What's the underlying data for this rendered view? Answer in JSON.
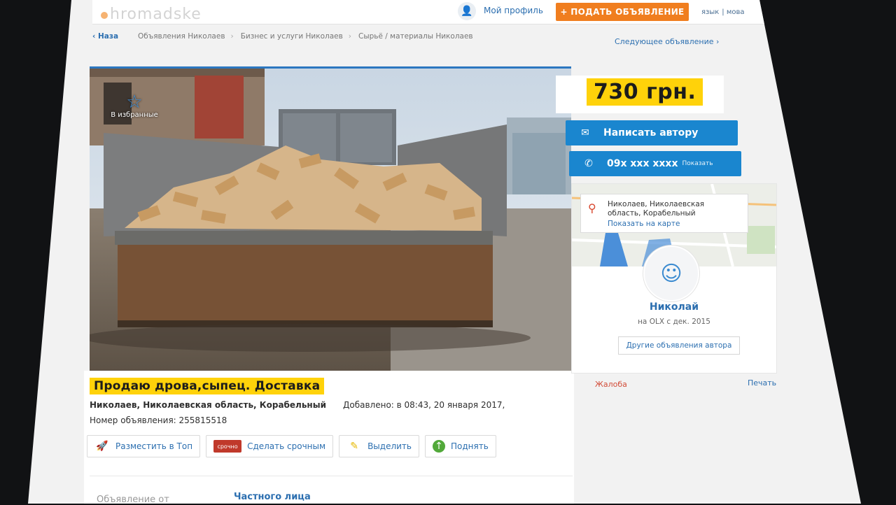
{
  "watermark": "hromadske",
  "header": {
    "profile_label": "Мой профиль",
    "post_ad_label": "+ ПОДАТЬ ОБЪЯВЛЕНИЕ",
    "lang": [
      "язык",
      "мова"
    ]
  },
  "breadcrumbs": {
    "back": "‹ Наза",
    "items": [
      "Объявления Николаев",
      "Бизнес и услуги Николаев",
      "Сырьё / материалы Николаев"
    ],
    "next": "Следующее объявление ›"
  },
  "photo": {
    "favorite_label": "В избранные"
  },
  "ad": {
    "title": "Продаю дрова,сыпец. Доставка",
    "location": "Николаев, Николаевская область, Корабельный",
    "added": "Добавлено: в 08:43, 20 января 2017,",
    "number_label": "Номер объявления:",
    "number": "255815518",
    "actions": [
      "Разместить в Топ",
      "Сделать срочным",
      "Выделить",
      "Поднять"
    ],
    "tab_static": "Объявление от",
    "tab_private": "Частного лица"
  },
  "sidebar": {
    "price": "730 грн.",
    "write_author": "Написать автору",
    "phone": "09x xxx xxxx",
    "phone_show": "Показать",
    "location_line1": "Николаев, Николаевская",
    "location_line2": "область, Корабельный",
    "show_on_map": "Показать на карте",
    "user_name": "Николай",
    "user_since": "на OLX с дек. 2015",
    "other_ads": "Другие объявления автора",
    "complain": "Жалоба",
    "print": "Печать"
  }
}
